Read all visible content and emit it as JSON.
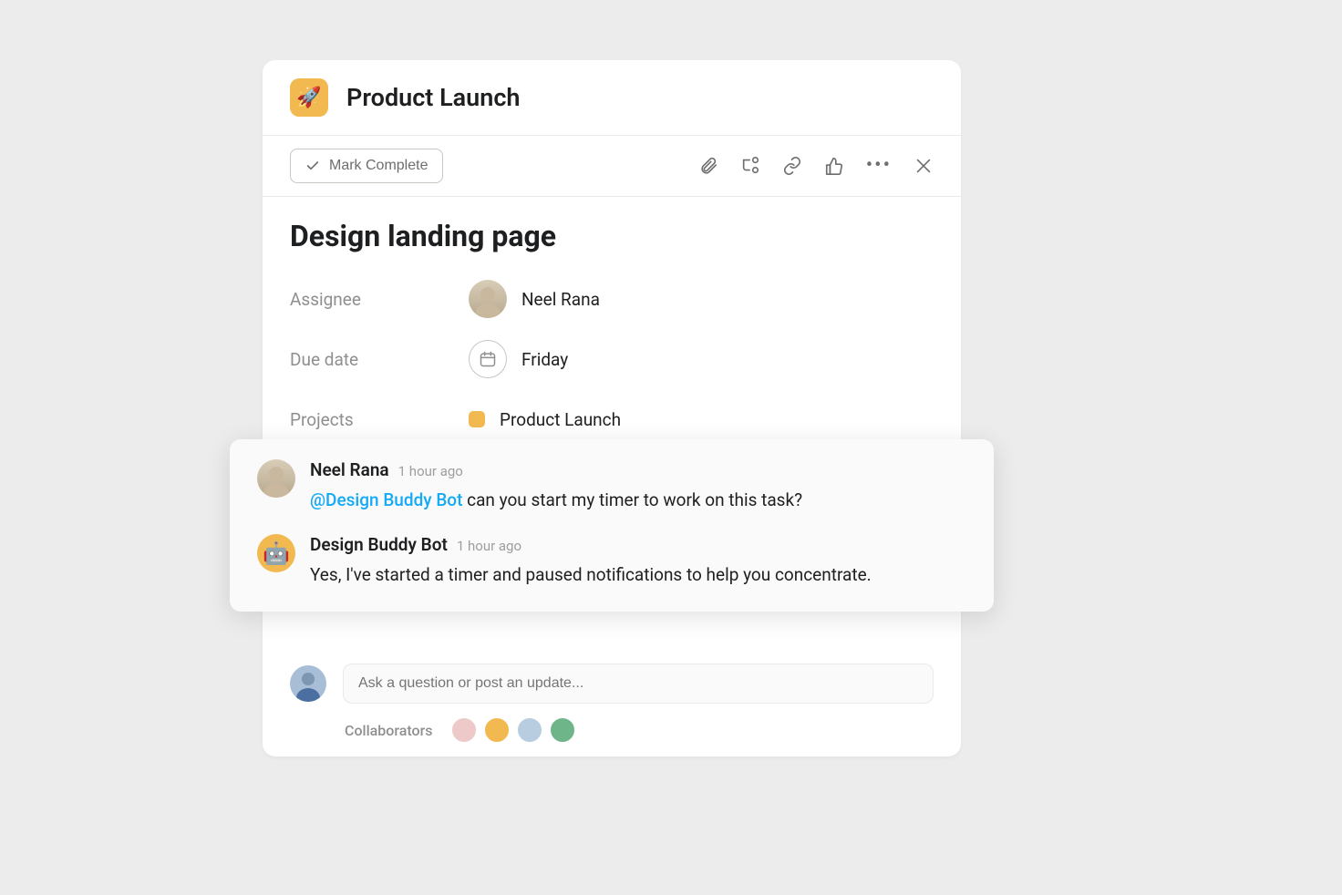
{
  "header": {
    "project_emoji": "🚀",
    "project_title": "Product Launch"
  },
  "toolbar": {
    "mark_complete_label": "Mark Complete"
  },
  "task": {
    "title": "Design landing page",
    "fields": {
      "assignee_label": "Assignee",
      "assignee_name": "Neel Rana",
      "due_date_label": "Due date",
      "due_date_value": "Friday",
      "projects_label": "Projects",
      "projects_value": "Product Launch"
    }
  },
  "comments": [
    {
      "author": "Neel Rana",
      "time": "1 hour ago",
      "mention": "@Design Buddy Bot",
      "body_rest": " can you start my timer to work on this task?"
    },
    {
      "author": "Design Buddy Bot",
      "time": "1 hour ago",
      "body": "Yes, I've started a timer and paused notifications to help you concentrate."
    }
  ],
  "input": {
    "placeholder": "Ask a question or post an update..."
  },
  "collaborators": {
    "label": "Collaborators"
  }
}
